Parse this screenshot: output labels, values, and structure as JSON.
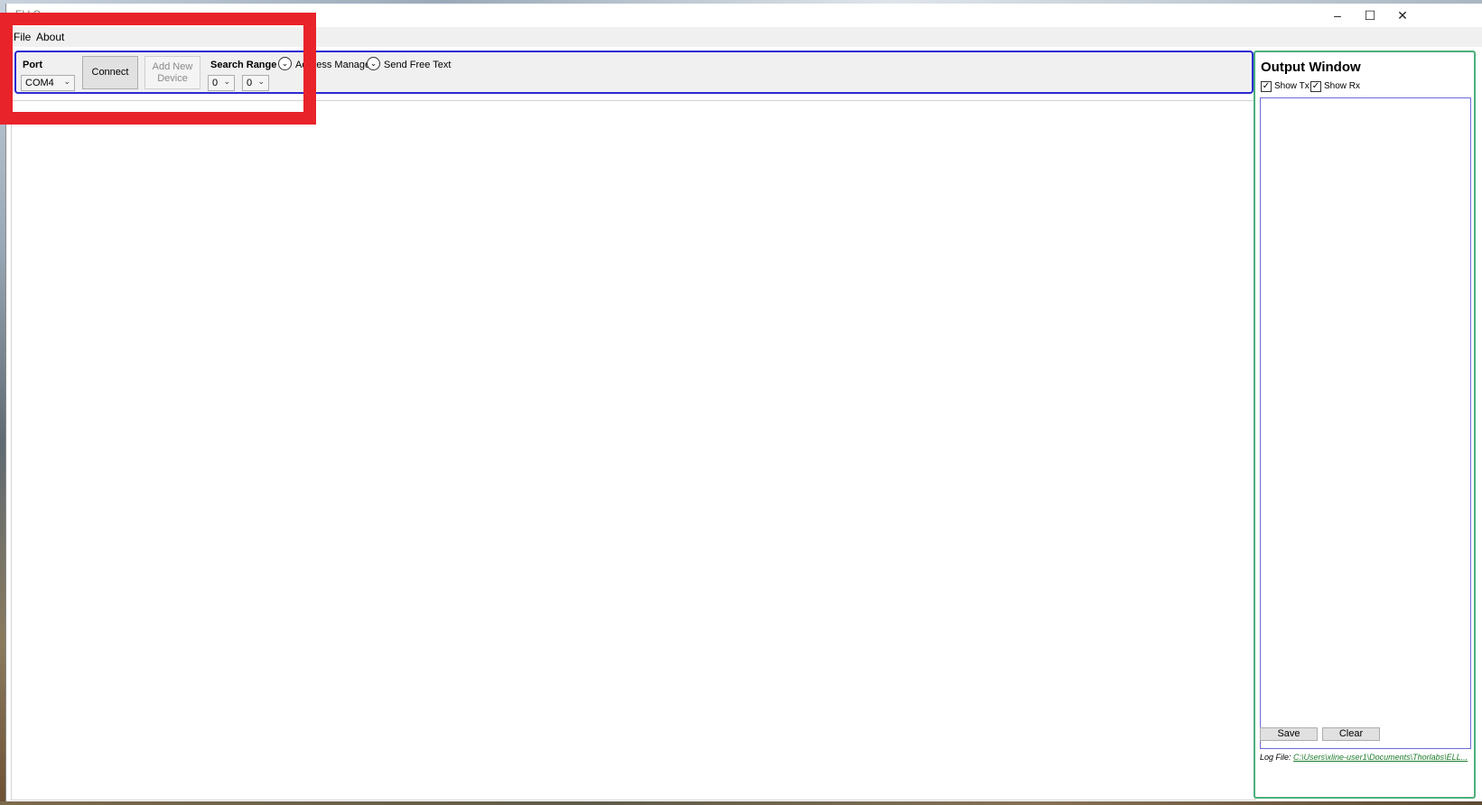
{
  "window": {
    "title": "ELLO",
    "controls": {
      "minimize": "–",
      "maximize": "☐",
      "close": "✕"
    }
  },
  "menu": [
    "File",
    "About"
  ],
  "toolbar": {
    "port_label": "Port",
    "port_value": "COM4",
    "connect_label": "Connect",
    "add_device_line1": "Add New",
    "add_device_line2": "Device",
    "search_range_label": "Search Range",
    "search_range_from": "0",
    "search_range_to": "0",
    "address_manager_label": "Address Manager",
    "send_free_text_label": "Send Free Text"
  },
  "output": {
    "title": "Output Window",
    "show_tx_label": "Show Tx",
    "show_tx_checked": true,
    "show_rx_label": "Show Rx",
    "show_rx_checked": true,
    "save_label": "Save",
    "clear_label": "Clear",
    "log_file_label": "Log File:",
    "log_file_path": "C:\\Users\\xline-user1\\Documents\\Thorlabs\\ELL..."
  },
  "colors": {
    "highlight": "#e8232a",
    "toolbar_border": "#2b2bd3",
    "output_border": "#4caf7a",
    "log_link": "#1c7c2a"
  }
}
